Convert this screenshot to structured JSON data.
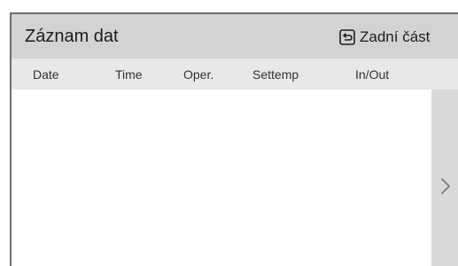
{
  "header": {
    "title": "Záznam dat",
    "back_label": "Zadní část"
  },
  "table": {
    "columns": [
      "Date",
      "Time",
      "Oper.",
      "Settemp",
      "In/Out"
    ],
    "rows": []
  },
  "icons": {
    "back": "return-arrow-icon",
    "next": "chevron-right-icon"
  },
  "colors": {
    "header_bg": "#d3d3d3",
    "column_header_bg": "#e8e8e8",
    "scroll_panel_bg": "#d9d9d9"
  }
}
